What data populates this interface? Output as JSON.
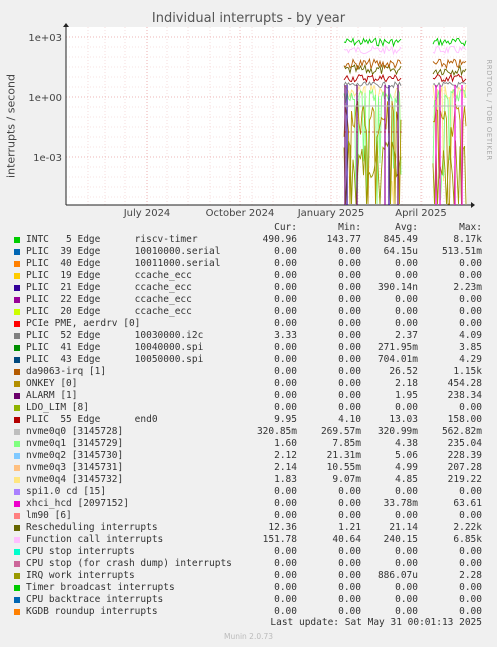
{
  "chart_data": {
    "type": "line",
    "title": "Individual interrupts - by year",
    "ylabel": "interrupts / second",
    "yscale": "log",
    "yticks": [
      "1e+03",
      "1e+00",
      "1e-03"
    ],
    "xticks": [
      "July 2024",
      "October 2024",
      "January 2025",
      "April 2025"
    ],
    "grid": true,
    "watermark": "RRDTOOL / TOBI OETIKER",
    "columns": [
      "Cur:",
      "Min:",
      "Avg:",
      "Max:"
    ],
    "series": [
      {
        "name": "INTC   5 Edge      riscv-timer",
        "color": "#00cc00",
        "cur": "490.96",
        "min": "143.77",
        "avg": "845.49",
        "max": "8.17k"
      },
      {
        "name": "PLIC  39 Edge      10010000.serial",
        "color": "#0066b3",
        "cur": "0.00",
        "min": "0.00",
        "avg": "64.15u",
        "max": "513.51m"
      },
      {
        "name": "PLIC  40 Edge      10011000.serial",
        "color": "#ff8000",
        "cur": "0.00",
        "min": "0.00",
        "avg": "0.00",
        "max": "0.00"
      },
      {
        "name": "PLIC  19 Edge      ccache_ecc",
        "color": "#ffcc00",
        "cur": "0.00",
        "min": "0.00",
        "avg": "0.00",
        "max": "0.00"
      },
      {
        "name": "PLIC  21 Edge      ccache_ecc",
        "color": "#330099",
        "cur": "0.00",
        "min": "0.00",
        "avg": "390.14n",
        "max": "2.23m"
      },
      {
        "name": "PLIC  22 Edge      ccache_ecc",
        "color": "#990099",
        "cur": "0.00",
        "min": "0.00",
        "avg": "0.00",
        "max": "0.00"
      },
      {
        "name": "PLIC  20 Edge      ccache_ecc",
        "color": "#ccff00",
        "cur": "0.00",
        "min": "0.00",
        "avg": "0.00",
        "max": "0.00"
      },
      {
        "name": "PCIe PME, aerdrv [0]",
        "color": "#ff0000",
        "cur": "0.00",
        "min": "0.00",
        "avg": "0.00",
        "max": "0.00"
      },
      {
        "name": "PLIC  52 Edge      10030000.i2c",
        "color": "#808080",
        "cur": "3.33",
        "min": "0.00",
        "avg": "2.37",
        "max": "4.09"
      },
      {
        "name": "PLIC  41 Edge      10040000.spi",
        "color": "#008f00",
        "cur": "0.00",
        "min": "0.00",
        "avg": "271.95m",
        "max": "3.85"
      },
      {
        "name": "PLIC  43 Edge      10050000.spi",
        "color": "#00487d",
        "cur": "0.00",
        "min": "0.00",
        "avg": "704.01m",
        "max": "4.29"
      },
      {
        "name": "da9063-irq [1]",
        "color": "#b35a00",
        "cur": "0.00",
        "min": "0.00",
        "avg": "26.52",
        "max": "1.15k"
      },
      {
        "name": "ONKEY [0]",
        "color": "#b38f00",
        "cur": "0.00",
        "min": "0.00",
        "avg": "2.18",
        "max": "454.28"
      },
      {
        "name": "ALARM [1]",
        "color": "#6b006b",
        "cur": "0.00",
        "min": "0.00",
        "avg": "1.95",
        "max": "238.34"
      },
      {
        "name": "LDO_LIM [8]",
        "color": "#8fb300",
        "cur": "0.00",
        "min": "0.00",
        "avg": "0.00",
        "max": "0.00"
      },
      {
        "name": "PLIC  55 Edge      end0",
        "color": "#b30000",
        "cur": "9.95",
        "min": "4.10",
        "avg": "13.03",
        "max": "158.00"
      },
      {
        "name": "nvme0q0 [3145728]",
        "color": "#bebebe",
        "cur": "320.85m",
        "min": "269.57m",
        "avg": "320.99m",
        "max": "562.82m"
      },
      {
        "name": "nvme0q1 [3145729]",
        "color": "#80ff80",
        "cur": "1.60",
        "min": "7.85m",
        "avg": "4.38",
        "max": "235.04"
      },
      {
        "name": "nvme0q2 [3145730]",
        "color": "#80c9ff",
        "cur": "2.12",
        "min": "21.31m",
        "avg": "5.06",
        "max": "228.39"
      },
      {
        "name": "nvme0q3 [3145731]",
        "color": "#ffc080",
        "cur": "2.14",
        "min": "10.55m",
        "avg": "4.99",
        "max": "207.28"
      },
      {
        "name": "nvme0q4 [3145732]",
        "color": "#ffe680",
        "cur": "1.83",
        "min": "9.07m",
        "avg": "4.85",
        "max": "219.22"
      },
      {
        "name": "spi1.0 cd [15]",
        "color": "#aa80ff",
        "cur": "0.00",
        "min": "0.00",
        "avg": "0.00",
        "max": "0.00"
      },
      {
        "name": "xhci_hcd [2097152]",
        "color": "#ee00cc",
        "cur": "0.00",
        "min": "0.00",
        "avg": "33.78m",
        "max": "63.61"
      },
      {
        "name": "lm90 [6]",
        "color": "#ff8080",
        "cur": "0.00",
        "min": "0.00",
        "avg": "0.00",
        "max": "0.00"
      },
      {
        "name": "Rescheduling interrupts",
        "color": "#666600",
        "cur": "12.36",
        "min": "1.21",
        "avg": "21.14",
        "max": "2.22k"
      },
      {
        "name": "Function call interrupts",
        "color": "#ffbfff",
        "cur": "151.78",
        "min": "40.64",
        "avg": "240.15",
        "max": "6.85k"
      },
      {
        "name": "CPU stop interrupts",
        "color": "#00ffcc",
        "cur": "0.00",
        "min": "0.00",
        "avg": "0.00",
        "max": "0.00"
      },
      {
        "name": "CPU stop (for crash dump) interrupts",
        "color": "#cc6699",
        "cur": "0.00",
        "min": "0.00",
        "avg": "0.00",
        "max": "0.00"
      },
      {
        "name": "IRQ work interrupts",
        "color": "#999900",
        "cur": "0.00",
        "min": "0.00",
        "avg": "886.07u",
        "max": "2.28"
      },
      {
        "name": "Timer broadcast interrupts",
        "color": "#00cc00",
        "cur": "0.00",
        "min": "0.00",
        "avg": "0.00",
        "max": "0.00"
      },
      {
        "name": "CPU backtrace interrupts",
        "color": "#0066b3",
        "cur": "0.00",
        "min": "0.00",
        "avg": "0.00",
        "max": "0.00"
      },
      {
        "name": "KGDB roundup interrupts",
        "color": "#ff8000",
        "cur": "0.00",
        "min": "0.00",
        "avg": "0.00",
        "max": "0.00"
      }
    ]
  },
  "footer": {
    "last_update": "Last update: Sat May 31 00:01:13 2025",
    "version": "Munin 2.0.73"
  }
}
